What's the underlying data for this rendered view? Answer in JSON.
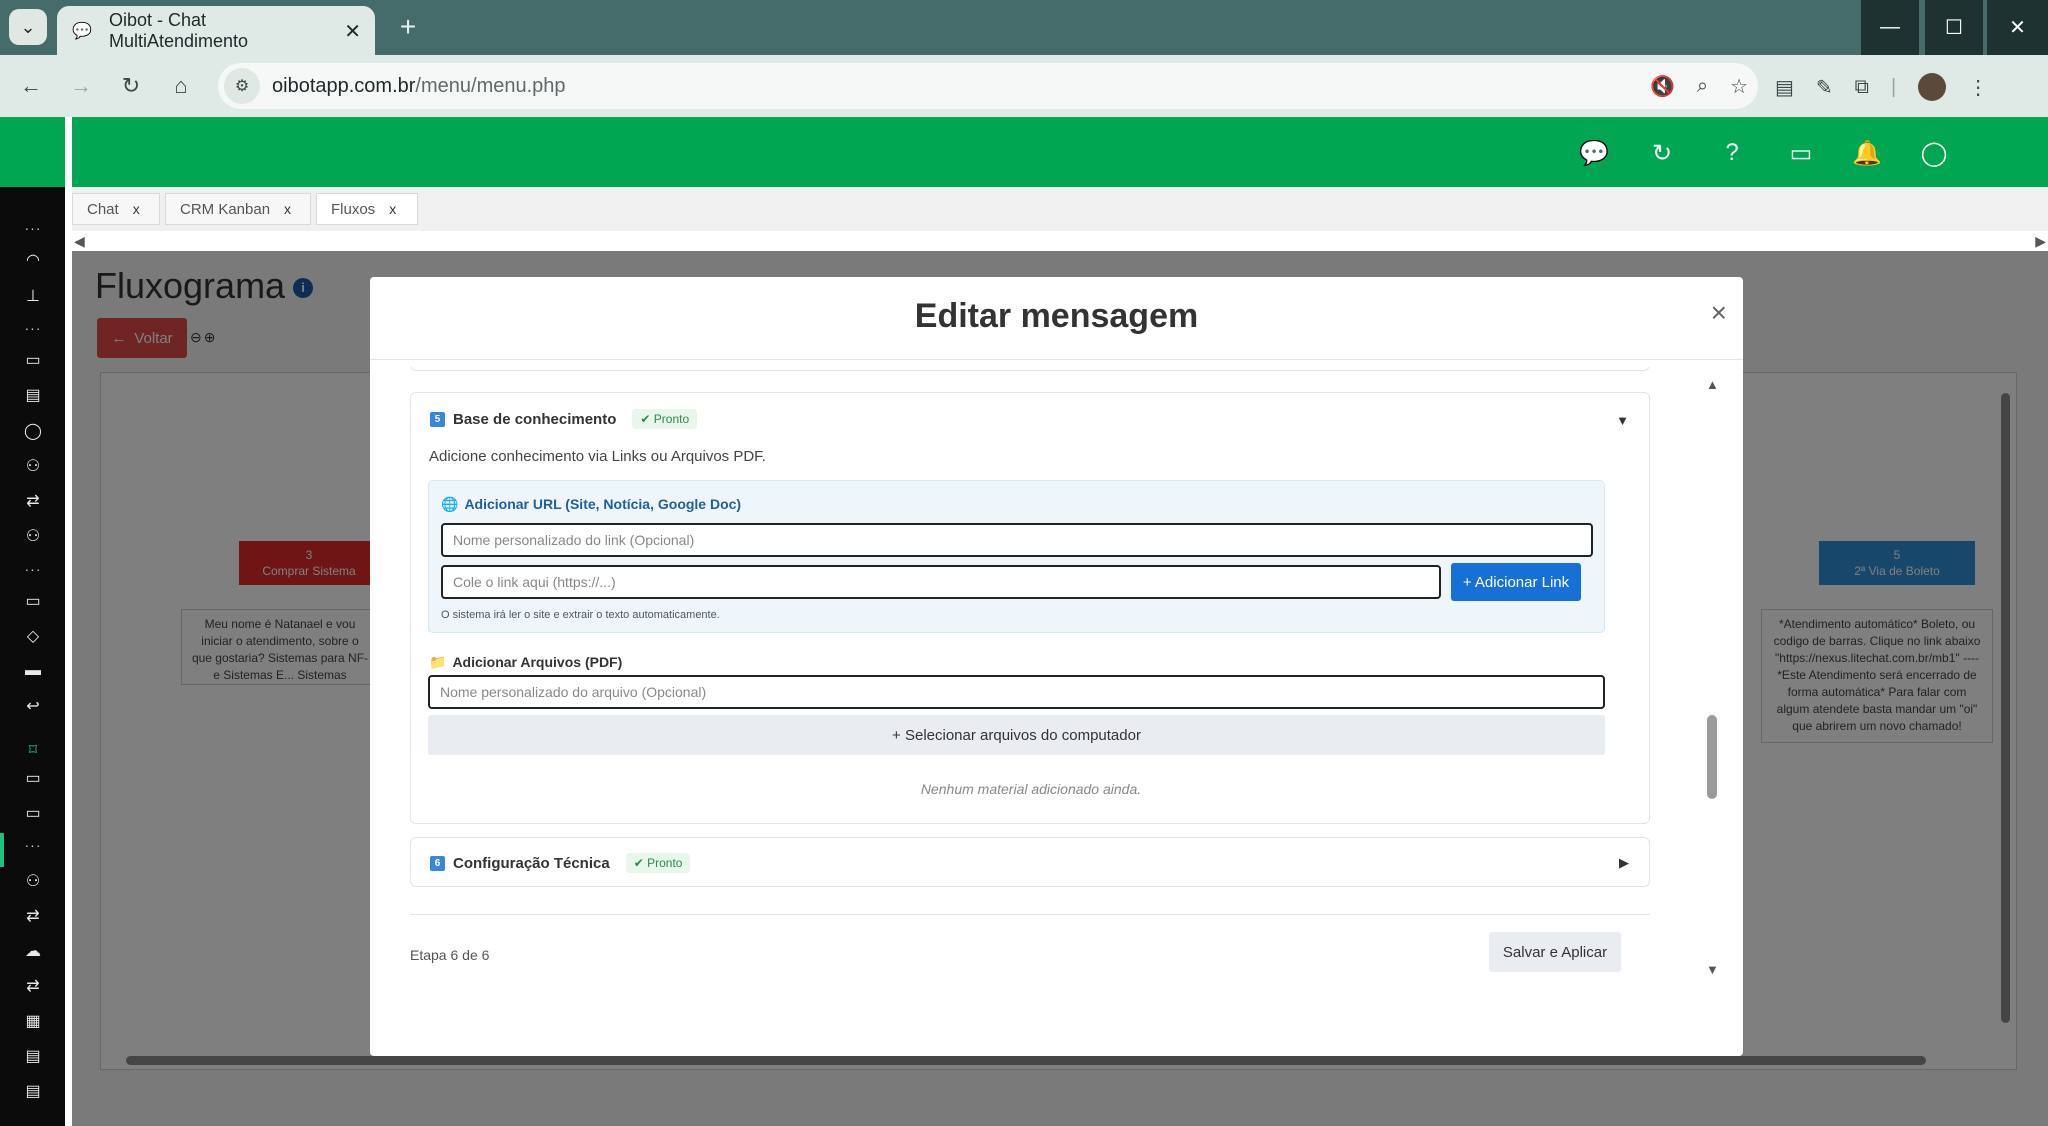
{
  "browser": {
    "tab_title": "Oibot - Chat MultiAtendimento",
    "url_host": "oibotapp.com.br",
    "url_path": "/menu/menu.php"
  },
  "app_tabs": [
    {
      "label": "Chat",
      "close": "x"
    },
    {
      "label": "CRM Kanban",
      "close": "x"
    },
    {
      "label": "Fluxos",
      "close": "x"
    }
  ],
  "page": {
    "title": "Fluxograma",
    "info": "i",
    "back_label": "Voltar"
  },
  "flow_nodes": {
    "node3_number": "3",
    "node3_label": "Comprar Sistema",
    "node3_text": "Meu nome é Natanael e vou iniciar o atendimento, sobre o que gostaria? Sistemas para NF-e Sistemas E... Sistemas Completos",
    "node5_number": "5",
    "node5_label": "2ª Via de Boleto",
    "node5_text": "*Atendimento automático* Boleto, ou codigo de barras. Clique no link abaixo \"https://nexus.litechat.com.br/mb1\" ---- *Este Atendimento será encerrado de forma automática* Para falar com algum atendete basta mandar um \"oi\" que abrirem um novo chamado!"
  },
  "modal": {
    "title": "Editar mensagem",
    "close": "×",
    "knowledge": {
      "number": "5",
      "title": "Base de conhecimento",
      "status": "Pronto",
      "description": "Adicione conhecimento via Links ou Arquivos PDF.",
      "url_section_title": "Adicionar URL (Site, Notícia, Google Doc)",
      "link_name_placeholder": "Nome personalizado do link (Opcional)",
      "link_url_placeholder": "Cole o link aqui (https://...)",
      "add_link_button": "+ Adicionar Link",
      "url_hint": "O sistema irá ler o site e extrair o texto automaticamente.",
      "pdf_section_title": "Adicionar Arquivos (PDF)",
      "file_name_placeholder": "Nome personalizado do arquivo (Opcional)",
      "select_files_button": "+ Selecionar arquivos do computador",
      "empty_note": "Nenhum material adicionado ainda."
    },
    "technical": {
      "number": "6",
      "title": "Configuração Técnica",
      "status": "Pronto"
    },
    "step_text": "Etapa 6 de 6",
    "save_button": "Salvar e Aplicar"
  },
  "colors": {
    "brand_green": "#00a651",
    "chrome_teal": "#456b6b",
    "primary_blue": "#1670d6",
    "node_red": "#e02b2b",
    "node_blue": "#2f8fd6"
  }
}
